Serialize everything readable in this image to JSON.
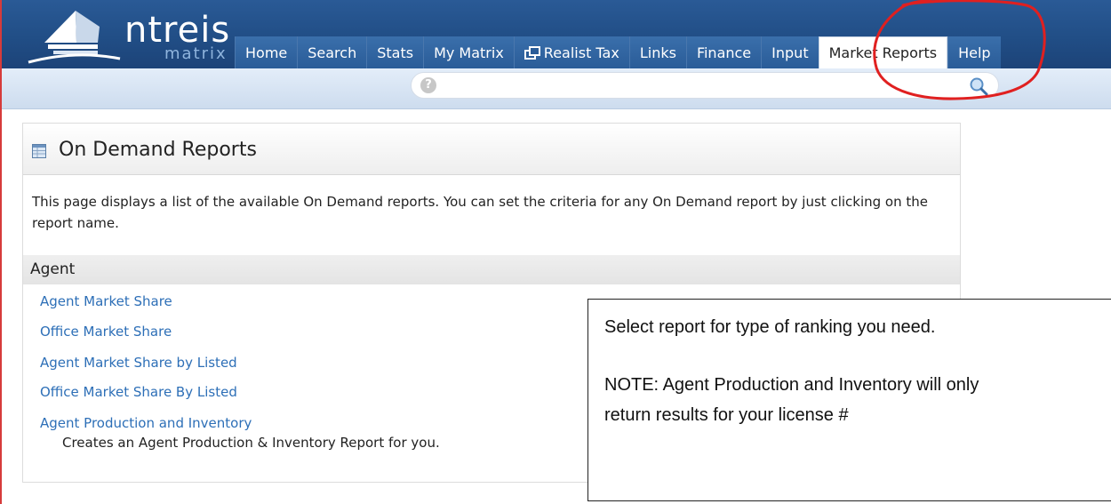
{
  "logo": {
    "name": "ntreis",
    "sub": "matrix"
  },
  "nav": {
    "tabs": [
      {
        "label": "Home"
      },
      {
        "label": "Search"
      },
      {
        "label": "Stats"
      },
      {
        "label": "My Matrix"
      },
      {
        "label": "Realist Tax",
        "icon": "window-icon"
      },
      {
        "label": "Links"
      },
      {
        "label": "Finance"
      },
      {
        "label": "Input"
      },
      {
        "label": "Market Reports",
        "active": true
      },
      {
        "label": "Help"
      }
    ]
  },
  "search": {
    "value": "",
    "placeholder": ""
  },
  "panel": {
    "title": "On Demand Reports",
    "description": "This page displays a list of the available On Demand reports. You can set the criteria for any On Demand report by just clicking on the report name.",
    "section": "Agent",
    "reports": [
      {
        "label": "Agent Market Share"
      },
      {
        "label": "Office Market Share"
      },
      {
        "label": "Agent Market Share by Listed"
      },
      {
        "label": "Office Market Share By Listed"
      },
      {
        "label": "Agent Production and Inventory",
        "description": "Creates an Agent Production & Inventory Report for you."
      }
    ]
  },
  "callout": {
    "line1": "Select report for type of ranking you need.",
    "line2": "NOTE: Agent Production and Inventory will only",
    "line3": "return results for your license #"
  },
  "colors": {
    "nav_bg": "#214e86",
    "link": "#2d6fb7",
    "annotation": "#e02020"
  }
}
